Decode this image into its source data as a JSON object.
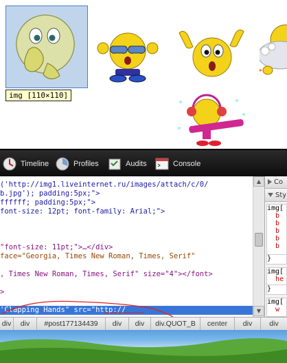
{
  "page": {
    "element_tooltip": "img [110×110]",
    "emoticons": [
      {
        "name": "shy-emoticon",
        "description": "smiley covering mouth"
      },
      {
        "name": "sunglasses-emoticon",
        "description": "smiley with sunglasses"
      },
      {
        "name": "surprised-emoticon",
        "description": "smiley raising hands"
      },
      {
        "name": "bathtub-emoticon",
        "description": "smiley in bathtub"
      },
      {
        "name": "winter-emoticon",
        "description": "smiley with earmuffs and scarf"
      }
    ]
  },
  "devtools": {
    "tabs": [
      {
        "label": "Timeline",
        "icon": "timeline-icon"
      },
      {
        "label": "Profiles",
        "icon": "profiles-icon"
      },
      {
        "label": "Audits",
        "icon": "audits-icon"
      },
      {
        "label": "Console",
        "icon": "console-icon"
      }
    ],
    "code_lines": [
      {
        "text": "('http://img1.liveinternet.ru/images/attach/c/0/",
        "kind": "str"
      },
      {
        "text": "b.jpg'); padding:5px;\">",
        "kind": "str"
      },
      {
        "text": "ffffff; padding:5px;\">",
        "kind": "str"
      },
      {
        "text": "font-size: 12pt; font-family: Arial;\">",
        "kind": "str"
      },
      {
        "text": "",
        "kind": "txt"
      },
      {
        "text": "",
        "kind": "txt"
      },
      {
        "text": "",
        "kind": "txt"
      },
      {
        "text": "\"font-size: 11pt;\">…</div>",
        "kind": "mix1"
      },
      {
        "text": "face=\"Georgia, Times New Roman, Times, Serif\"",
        "kind": "mix2"
      },
      {
        "text": "",
        "kind": "txt"
      },
      {
        "text": ", Times New Roman, Times, Serif\" size=\"4\"></font>",
        "kind": "mix3"
      },
      {
        "text": "",
        "kind": "txt"
      },
      {
        "text": ">",
        "kind": "tag"
      }
    ],
    "selected_line": "'Clapping Hands\" src=\"http://",
    "side_panel": {
      "sections": [
        {
          "label": "Co",
          "collapsed": true
        },
        {
          "label": "Sty",
          "collapsed": false
        }
      ],
      "rules": [
        {
          "selector": "img[",
          "props": [
            "b",
            "b",
            "b",
            "b",
            "b"
          ]
        },
        {
          "selector": "}",
          "props": []
        },
        {
          "selector": "img[",
          "props": [
            "he"
          ]
        },
        {
          "selector": "}",
          "props": []
        },
        {
          "selector": "img[",
          "props": [
            "w"
          ]
        }
      ]
    },
    "breadcrumbs": [
      "div",
      "div",
      "#post177134439",
      "div",
      "div",
      "div.QUOT_B",
      "center",
      "div",
      "div"
    ]
  },
  "colors": {
    "toolbar_bg": "#1a1a1a",
    "selection_bg": "#3875d7",
    "highlight_box": "#8cb2dc"
  }
}
